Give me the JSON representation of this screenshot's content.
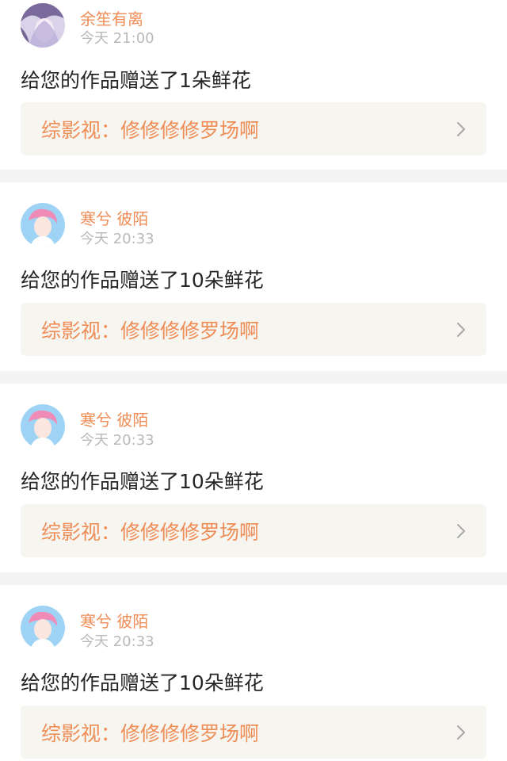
{
  "notifications": [
    {
      "author": "余笙有离",
      "time": "今天 21:00",
      "message": "给您的作品赠送了1朵鲜花",
      "work_title": "综影视：修修修修罗场啊",
      "avatar_icon": "purple-portrait-avatar"
    },
    {
      "author": "寒兮 彼陌",
      "time": "今天 20:33",
      "message": "给您的作品赠送了10朵鲜花",
      "work_title": "综影视：修修修修罗场啊",
      "avatar_icon": "pink-hair-portrait-avatar"
    },
    {
      "author": "寒兮 彼陌",
      "time": "今天 20:33",
      "message": "给您的作品赠送了10朵鲜花",
      "work_title": "综影视：修修修修罗场啊",
      "avatar_icon": "pink-hair-portrait-avatar"
    },
    {
      "author": "寒兮 彼陌",
      "time": "今天 20:33",
      "message": "给您的作品赠送了10朵鲜花",
      "work_title": "综影视：修修修修罗场啊",
      "avatar_icon": "pink-hair-portrait-avatar"
    }
  ],
  "colors": {
    "accent": "#ef8d57",
    "time": "#b9b9b9",
    "text": "#262626",
    "link_bg": "#f6f5f0",
    "separator": "#f4f4f4"
  }
}
